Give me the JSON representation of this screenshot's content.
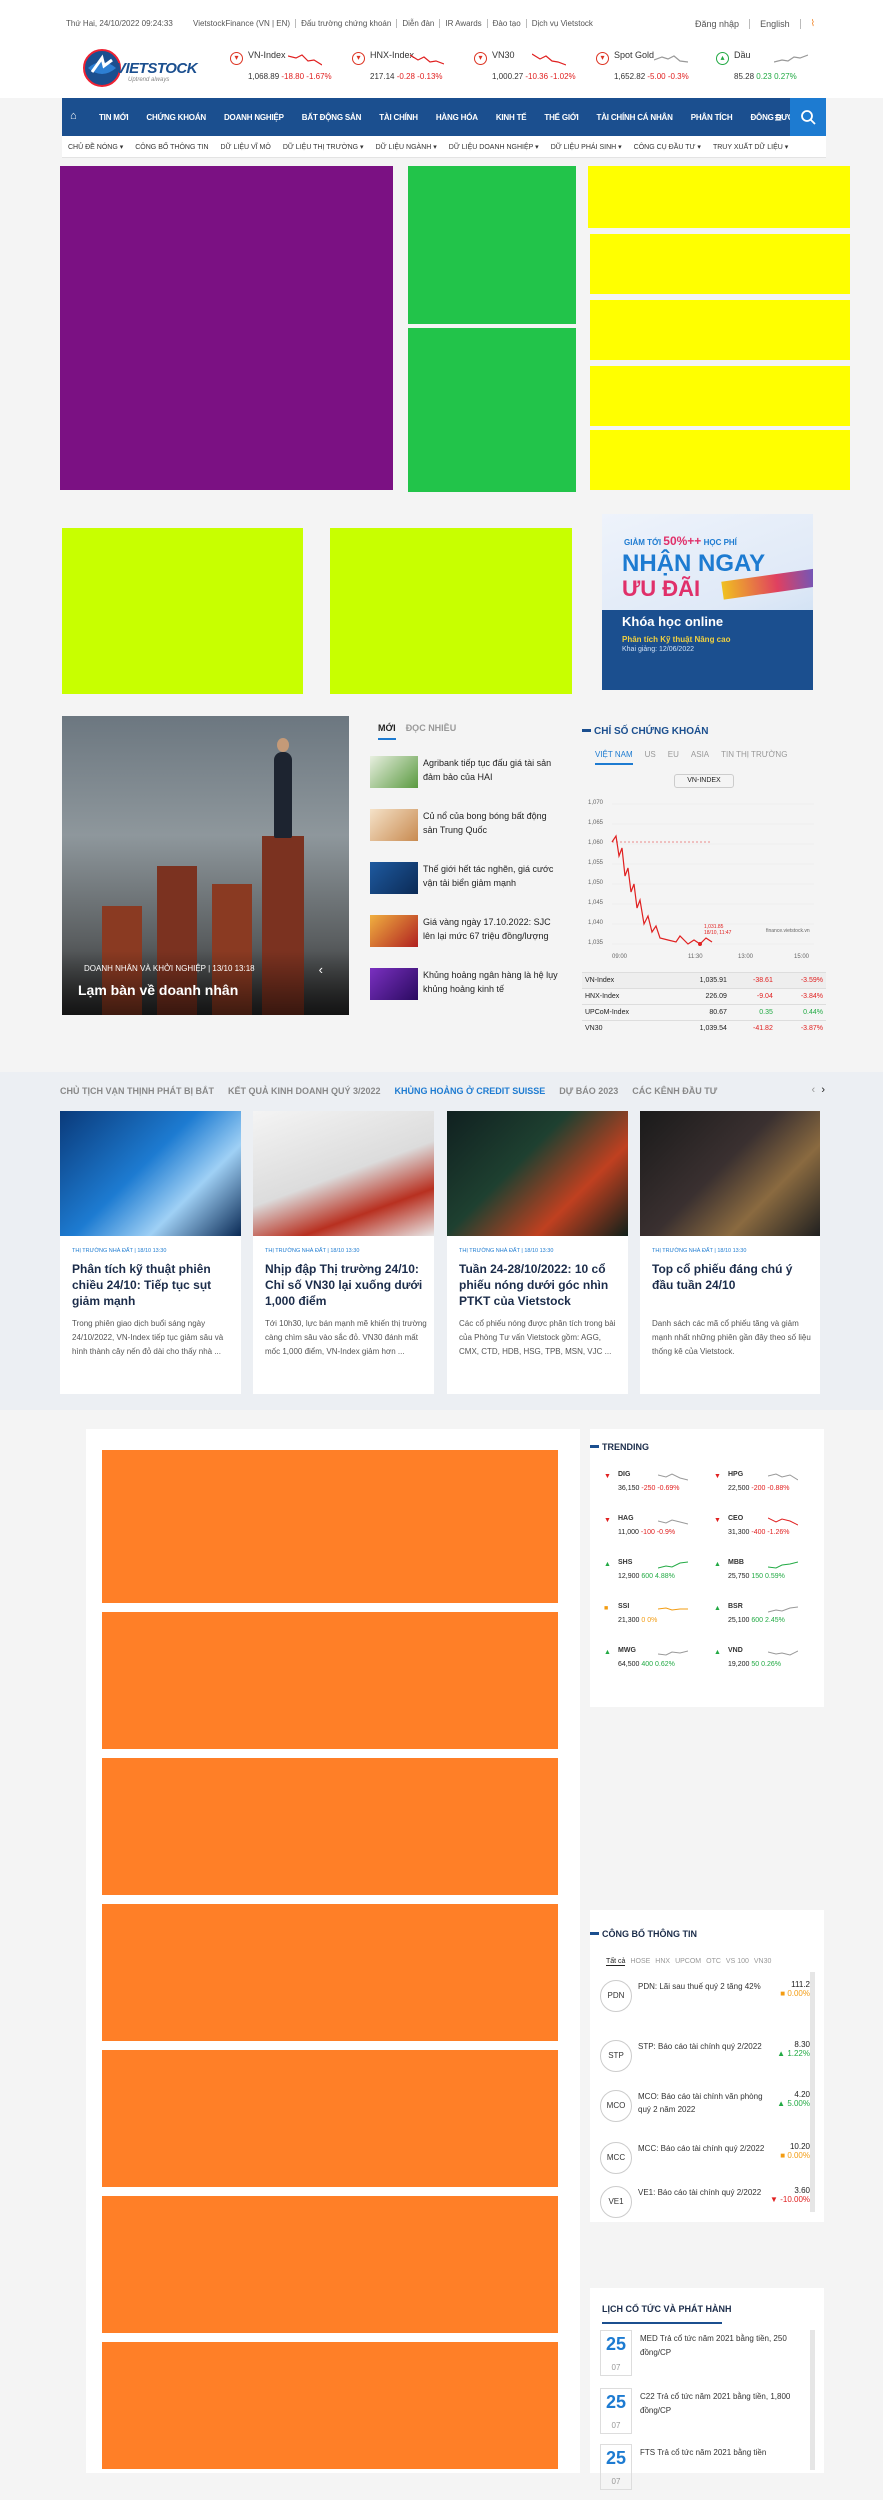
{
  "topbar": {
    "date": "Thứ Hai, 24/10/2022  09:24:33",
    "links": [
      "VietstockFinance (VN | EN)",
      "Đấu trường chứng khoán",
      "Diễn đàn",
      "IR Awards",
      "Đào tạo",
      "Dịch vụ Vietstock"
    ],
    "login": "Đăng nhập",
    "language": "English",
    "rss_icon": "rss-icon"
  },
  "logo": {
    "text": "VIETSTOCK",
    "tagline": "Uptrend always"
  },
  "tickers": [
    {
      "name": "VN-Index",
      "value": "1,068.89",
      "change": "-18.80",
      "pct": "-1.67%",
      "color": "#e02020",
      "dir": "down"
    },
    {
      "name": "HNX-Index",
      "value": "217.14",
      "change": "-0.28",
      "pct": "-0.13%",
      "color": "#e02020",
      "dir": "down"
    },
    {
      "name": "VN30",
      "value": "1,000.27",
      "change": "-10.36",
      "pct": "-1.02%",
      "color": "#e02020",
      "dir": "down"
    },
    {
      "name": "Spot Gold",
      "value": "1,652.82",
      "change": "-5.00",
      "pct": "-0.3%",
      "color": "#e02020",
      "dir": "down"
    },
    {
      "name": "Dầu",
      "value": "85.28",
      "change": "0.23",
      "pct": "0.27%",
      "color": "#22aa44",
      "dir": "up"
    }
  ],
  "nav": {
    "items": [
      "TIN MỚI",
      "CHỨNG KHOÁN",
      "DOANH NGHIỆP",
      "BẤT ĐỘNG SẢN",
      "TÀI CHÍNH",
      "HÀNG HÓA",
      "KINH TẾ",
      "THẾ GIỚI",
      "TÀI CHÍNH CÁ NHÂN",
      "PHÂN TÍCH",
      "ĐÔNG DƯƠNG"
    ],
    "home_icon": "home-icon",
    "menu_icon": "hamburger-icon",
    "search_icon": "search-icon"
  },
  "subnav": [
    "CHỦ ĐỀ NÓNG ▾",
    "CÔNG BỐ THÔNG TIN",
    "DỮ LIỆU VĨ MÔ",
    "DỮ LIỆU THỊ TRƯỜNG ▾",
    "DỮ LIỆU NGÀNH ▾",
    "DỮ LIỆU DOANH NGHIỆP ▾",
    "DỮ LIỆU PHÁI SINH ▾",
    "CÔNG CỤ ĐẦU TƯ ▾",
    "TRUY XUẤT DỮ LIỆU ▾"
  ],
  "ad_banner": {
    "line1_prefix": "GIẢM TỚI",
    "line1_pct": "50%++",
    "line1_suffix": "HỌC PHÍ",
    "line2": "NHẬN NGAY",
    "line3": "ƯU ĐÃI",
    "line4": "Khóa học online",
    "line5": "Phân tích Kỹ thuật Nâng cao",
    "line6": "Khai giảng: 12/06/2022"
  },
  "hero": {
    "category": "DOANH NHÂN VÀ KHỞI NGHIỆP  |  13/10 13:18",
    "title": "Lạm bàn về doanh nhân"
  },
  "newslist": {
    "tabs": [
      "MỚI",
      "ĐỌC NHIỀU"
    ],
    "items": [
      "Agribank tiếp tục đấu giá tài sản đảm bảo của HAI",
      "Củ nổ của bong bóng bất động sản Trung Quốc",
      "Thế giới hết tác nghẽn, giá cước vận tải biển giảm mạnh",
      "Giá vàng ngày 17.10.2022: SJC lên lại mức 67 triệu đồng/lượng",
      "Khủng hoảng ngân hàng là hệ lụy khủng hoảng kinh tế"
    ]
  },
  "index_widget": {
    "title": "CHỈ SỐ CHỨNG KHOÁN",
    "tabs": [
      "VIỆT NAM",
      "US",
      "EU",
      "ASIA",
      "TIN THỊ TRƯỜNG"
    ],
    "selected": "VN-INDEX",
    "chart_yticks": [
      "1,070",
      "1,065",
      "1,060",
      "1,055",
      "1,050",
      "1,045",
      "1,040",
      "1,035"
    ],
    "chart_xticks": [
      "09:00",
      "11:30",
      "13:00",
      "15:00"
    ],
    "chart_annotation": "1,031.85\n18/10, 11:47",
    "source": "finance.vietstock.vn",
    "rows": [
      {
        "name": "VN-Index",
        "value": "1,035.91",
        "change": "-38.61",
        "pct": "-3.59%",
        "cls": "red"
      },
      {
        "name": "HNX-Index",
        "value": "226.09",
        "change": "-9.04",
        "pct": "-3.84%",
        "cls": "red"
      },
      {
        "name": "UPCoM-Index",
        "value": "80.67",
        "change": "0.35",
        "pct": "0.44%",
        "cls": "grn"
      },
      {
        "name": "VN30",
        "value": "1,039.54",
        "change": "-41.82",
        "pct": "-3.87%",
        "cls": "red"
      }
    ]
  },
  "strip": {
    "tags": [
      "CHỦ TỊCH VẠN THỊNH PHÁT BỊ BẮT",
      "KẾT QUẢ KINH DOANH QUÝ 3/2022",
      "KHỦNG HOẢNG Ở CREDIT SUISSE",
      "DỰ BÁO 2023",
      "CÁC KÊNH ĐẦU TƯ"
    ],
    "cards": [
      {
        "cat": "THỊ TRƯỜNG NHÀ ĐẤT   |   18/10 13:30",
        "title": "Phân tích kỹ thuật phiên chiều 24/10: Tiếp tục sụt giảm mạnh",
        "desc": "Trong phiên giao dịch buổi sáng ngày 24/10/2022, VN-Index tiếp tục giảm sâu và hình thành cây nến đỏ dài cho thấy nhà ..."
      },
      {
        "cat": "THỊ TRƯỜNG NHÀ ĐẤT   |   18/10 13:30",
        "title": "Nhịp đập Thị trường 24/10: Chỉ số VN30 lại xuống dưới 1,000 điểm",
        "desc": "Tới 10h30, lực bán mạnh mẽ khiến thị trường càng chìm sâu vào sắc đỏ. VN30 đánh mất mốc 1,000 điểm, VN-Index giảm hơn ..."
      },
      {
        "cat": "THỊ TRƯỜNG NHÀ ĐẤT   |   18/10 13:30",
        "title": "Tuần 24-28/10/2022: 10 cổ phiếu nóng dưới góc nhìn PTKT của Vietstock",
        "desc": "Các cổ phiếu nóng được phân tích trong bài của Phòng Tư vấn Vietstock gồm: AGG, CMX, CTD, HDB, HSG, TPB, MSN, VJC ..."
      },
      {
        "cat": "THỊ TRƯỜNG NHÀ ĐẤT   |   18/10 13:30",
        "title": "Top cổ phiếu đáng chú ý đầu tuần 24/10",
        "desc": "Danh sách các mã cổ phiếu tăng và giảm mạnh nhất những phiên gần đây theo số liệu thống kê của Vietstock."
      }
    ]
  },
  "trending": {
    "title": "TRENDING",
    "items": [
      {
        "code": "DIG",
        "price": "36,150",
        "chg": "-250",
        "pct": "-0.69%",
        "cls": "red",
        "icon": "▼"
      },
      {
        "code": "HPG",
        "price": "22,500",
        "chg": "-200",
        "pct": "-0.88%",
        "cls": "red",
        "icon": "▼"
      },
      {
        "code": "HAG",
        "price": "11,000",
        "chg": "-100",
        "pct": "-0.9%",
        "cls": "red",
        "icon": "▼"
      },
      {
        "code": "CEO",
        "price": "31,300",
        "chg": "-400",
        "pct": "-1.26%",
        "cls": "red",
        "icon": "▼"
      },
      {
        "code": "SHS",
        "price": "12,900",
        "chg": "600",
        "pct": "4.88%",
        "cls": "grn",
        "icon": "▲"
      },
      {
        "code": "MBB",
        "price": "25,750",
        "chg": "150",
        "pct": "0.59%",
        "cls": "grn",
        "icon": "▲"
      },
      {
        "code": "SSI",
        "price": "21,300",
        "chg": "0",
        "pct": "0%",
        "cls": "org",
        "icon": "■"
      },
      {
        "code": "BSR",
        "price": "25,100",
        "chg": "600",
        "pct": "2.45%",
        "cls": "grn",
        "icon": "▲"
      },
      {
        "code": "MWG",
        "price": "64,500",
        "chg": "400",
        "pct": "0.62%",
        "cls": "grn",
        "icon": "▲"
      },
      {
        "code": "VND",
        "price": "19,200",
        "chg": "50",
        "pct": "0.26%",
        "cls": "grn",
        "icon": "▲"
      }
    ]
  },
  "congbo": {
    "title": "CÔNG BỐ THÔNG TIN",
    "tabs": [
      "Tất cả",
      "HOSE",
      "HNX",
      "UPCOM",
      "OTC",
      "VS 100",
      "VN30"
    ],
    "items": [
      {
        "code": "PDN",
        "text": "PDN: Lãi sau thuế quý 2 tăng 42%",
        "price": "111.2",
        "pct": "0.00%",
        "cls": "org",
        "icon": "■"
      },
      {
        "code": "STP",
        "text": "STP: Báo cáo tài chính quý 2/2022",
        "price": "8.30",
        "pct": "1.22%",
        "cls": "grn",
        "icon": "▲"
      },
      {
        "code": "MCO",
        "text": "MCO: Báo cáo tài chính văn phòng quý 2 năm 2022",
        "price": "4.20",
        "pct": "5.00%",
        "cls": "grn",
        "icon": "▲"
      },
      {
        "code": "MCC",
        "text": "MCC: Báo cáo tài chính quý 2/2022",
        "price": "10.20",
        "pct": "0.00%",
        "cls": "org",
        "icon": "■"
      },
      {
        "code": "VE1",
        "text": "VE1: Báo cáo tài chính quý 2/2022",
        "price": "3.60",
        "pct": "-10.00%",
        "cls": "red",
        "icon": "▼"
      }
    ]
  },
  "lichcotuc": {
    "title": "LỊCH CỔ TỨC VÀ PHÁT HÀNH",
    "items": [
      {
        "day": "25",
        "mon": "07",
        "text": "MED Trả cổ tức năm 2021 bằng tiền, 250 đồng/CP"
      },
      {
        "day": "25",
        "mon": "07",
        "text": "C22 Trả cổ tức năm 2021 bằng tiền, 1,800 đồng/CP"
      },
      {
        "day": "25",
        "mon": "07",
        "text": "FTS Trả cổ tức năm 2021 bằng tiền"
      }
    ]
  },
  "colors": {
    "purple": "#7b1183",
    "green": "#22c44a",
    "yellow": "#ffff00",
    "lime": "#c8ff00",
    "orange": "#ff7f27",
    "nav": "#1b4f8f",
    "accent": "#1d7bd1"
  }
}
